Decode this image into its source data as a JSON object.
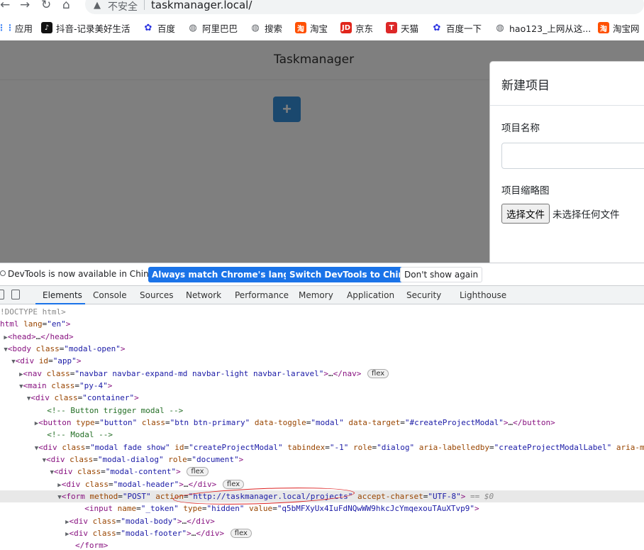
{
  "browser": {
    "insecure_label": "不安全",
    "url": "taskmanager.local/",
    "bookmarks": [
      {
        "label": "应用",
        "color": "#4285f4"
      },
      {
        "label": "抖音-记录美好生活",
        "color": "#111111"
      },
      {
        "label": "百度",
        "color": "#2932e1"
      },
      {
        "label": "阿里巴巴",
        "color": "#5f6368"
      },
      {
        "label": "搜索",
        "color": "#5f6368"
      },
      {
        "label": "淘宝",
        "color": "#ff5000"
      },
      {
        "label": "京东",
        "color": "#e1251b"
      },
      {
        "label": "天猫",
        "color": "#dd2727"
      },
      {
        "label": "百度一下",
        "color": "#2932e1"
      },
      {
        "label": "hao123_上网从这...",
        "color": "#5f6368"
      },
      {
        "label": "淘宝网",
        "color": "#ff5000"
      }
    ]
  },
  "page": {
    "brand": "Taskmanager",
    "add_button": "+",
    "modal": {
      "title": "新建项目",
      "name_label": "项目名称",
      "name_value": "",
      "thumb_label": "项目缩略图",
      "file_button": "选择文件",
      "file_status": "未选择任何文件"
    }
  },
  "devtools": {
    "info_text": "DevTools is now available in Chinese!",
    "btn_match": "Always match Chrome's language",
    "btn_switch": "Switch DevTools to Chinese",
    "btn_dismiss": "Don't show again",
    "tabs": [
      "Elements",
      "Console",
      "Sources",
      "Network",
      "Performance",
      "Memory",
      "Application",
      "Security",
      "Lighthouse"
    ],
    "active_tab": "Elements"
  },
  "colors": {
    "accent": "#1a73e8",
    "primary_button": "#3490dc",
    "annotation_circle": "#dd2222"
  }
}
